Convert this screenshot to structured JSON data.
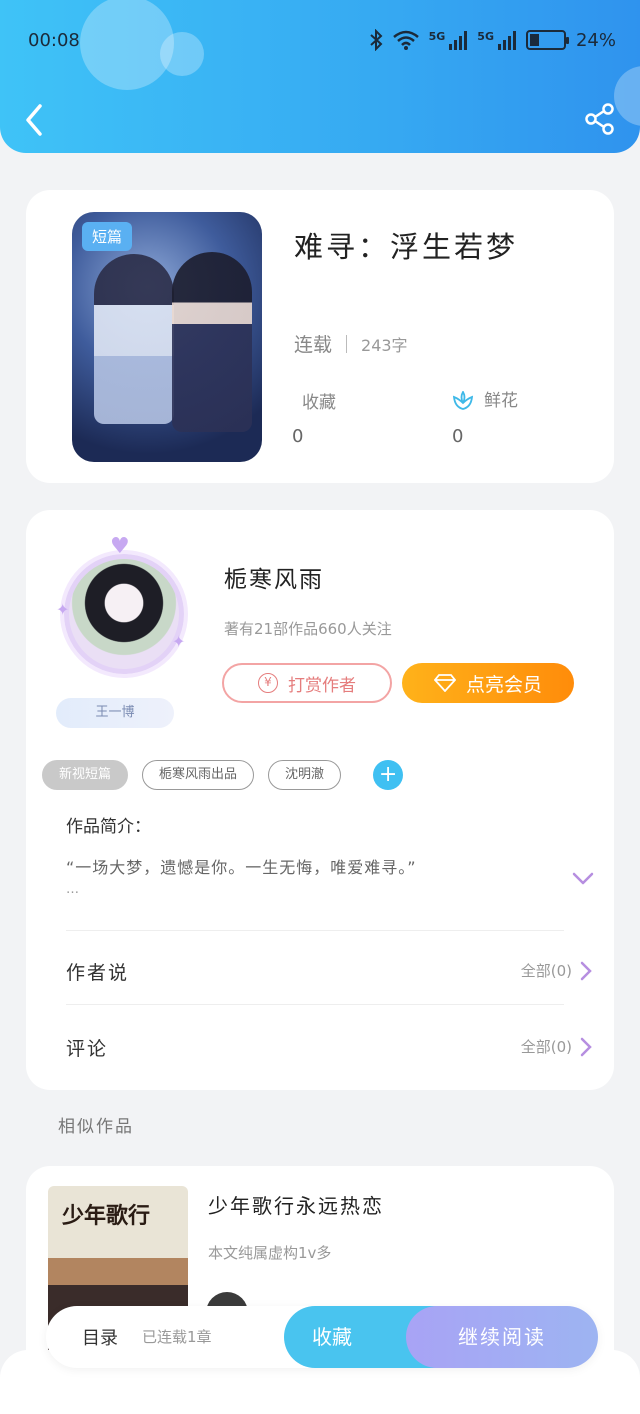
{
  "status_bar": {
    "time": "00:08",
    "network1": "5G",
    "network2": "5G",
    "battery": "24%"
  },
  "colors": {
    "accent": "#3fc0f2",
    "vip": "#ff9c12",
    "tip": "#e57d7d",
    "read": "#a8a3f5"
  },
  "book": {
    "tag": "短篇",
    "title": "难寻：浮生若梦",
    "serial_status": "连载",
    "word_count": "243字",
    "favorites_label": "收藏",
    "favorites_value": "0",
    "flowers_label": "鲜花",
    "flowers_value": "0"
  },
  "author": {
    "badge": "王一博",
    "name": "栀寒风雨",
    "stats": "著有21部作品660人关注",
    "tip_label": "打赏作者",
    "vip_label": "点亮会员"
  },
  "tags": [
    "新视短篇",
    "栀寒风雨出品",
    "沈明澈"
  ],
  "intro": {
    "label": "作品简介：",
    "text": "“一场大梦，遗憾是你。一生无悔，唯爱难寻。”",
    "ellipsis": "…"
  },
  "rows": {
    "author_says": {
      "label": "作者说",
      "value": "全部(0)"
    },
    "comments": {
      "label": "评论",
      "value": "全部(0)"
    }
  },
  "similar": {
    "section_title": "相似作品",
    "items": [
      {
        "cover_text": "少年歌行",
        "title": "少年歌行永远热恋",
        "desc": "本文纯属虚构1v多"
      }
    ]
  },
  "bottom_bar": {
    "directory": "目录",
    "progress": "已连载1章",
    "favorite": "收藏",
    "continue": "继续阅读"
  }
}
